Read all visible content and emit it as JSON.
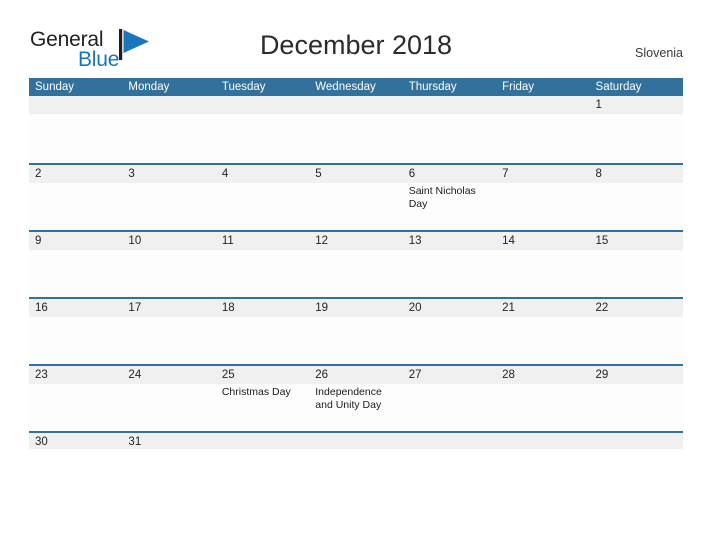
{
  "brand": {
    "name_part1": "General",
    "name_part2": "Blue",
    "mark": "blue-flag-triangle",
    "color_dark": "#231f20",
    "color_blue": "#1b75bb"
  },
  "header": {
    "title": "December 2018",
    "country": "Slovenia"
  },
  "theme": {
    "header_blue": "#31719B",
    "row_gray": "#F0F0F0",
    "page_background": "#FFFFFF",
    "text_dark": "#232323"
  },
  "calendar": {
    "month": "December",
    "year": "2018",
    "weekday_headers": [
      "Sunday",
      "Monday",
      "Tuesday",
      "Wednesday",
      "Thursday",
      "Friday",
      "Saturday"
    ],
    "weeks": [
      {
        "days": [
          {
            "num": "",
            "event": ""
          },
          {
            "num": "",
            "event": ""
          },
          {
            "num": "",
            "event": ""
          },
          {
            "num": "",
            "event": ""
          },
          {
            "num": "",
            "event": ""
          },
          {
            "num": "",
            "event": ""
          },
          {
            "num": "1",
            "event": ""
          }
        ]
      },
      {
        "days": [
          {
            "num": "2",
            "event": ""
          },
          {
            "num": "3",
            "event": ""
          },
          {
            "num": "4",
            "event": ""
          },
          {
            "num": "5",
            "event": ""
          },
          {
            "num": "6",
            "event": "Saint Nicholas Day"
          },
          {
            "num": "7",
            "event": ""
          },
          {
            "num": "8",
            "event": ""
          }
        ]
      },
      {
        "days": [
          {
            "num": "9",
            "event": ""
          },
          {
            "num": "10",
            "event": ""
          },
          {
            "num": "11",
            "event": ""
          },
          {
            "num": "12",
            "event": ""
          },
          {
            "num": "13",
            "event": ""
          },
          {
            "num": "14",
            "event": ""
          },
          {
            "num": "15",
            "event": ""
          }
        ]
      },
      {
        "days": [
          {
            "num": "16",
            "event": ""
          },
          {
            "num": "17",
            "event": ""
          },
          {
            "num": "18",
            "event": ""
          },
          {
            "num": "19",
            "event": ""
          },
          {
            "num": "20",
            "event": ""
          },
          {
            "num": "21",
            "event": ""
          },
          {
            "num": "22",
            "event": ""
          }
        ]
      },
      {
        "days": [
          {
            "num": "23",
            "event": ""
          },
          {
            "num": "24",
            "event": ""
          },
          {
            "num": "25",
            "event": "Christmas Day"
          },
          {
            "num": "26",
            "event": "Independence and Unity Day"
          },
          {
            "num": "27",
            "event": ""
          },
          {
            "num": "28",
            "event": ""
          },
          {
            "num": "29",
            "event": ""
          }
        ]
      },
      {
        "days": [
          {
            "num": "30",
            "event": ""
          },
          {
            "num": "31",
            "event": ""
          },
          {
            "num": "",
            "event": ""
          },
          {
            "num": "",
            "event": ""
          },
          {
            "num": "",
            "event": ""
          },
          {
            "num": "",
            "event": ""
          },
          {
            "num": "",
            "event": ""
          }
        ]
      }
    ]
  }
}
